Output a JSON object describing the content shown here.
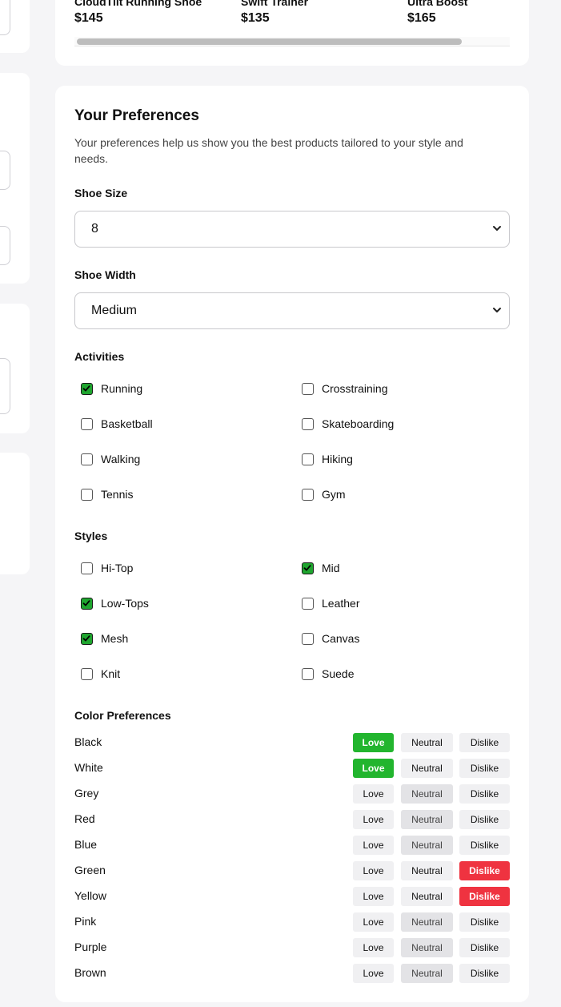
{
  "products": [
    {
      "name": "CloudTilt Running Shoe",
      "price": "$145"
    },
    {
      "name": "Swift Trainer",
      "price": "$135"
    },
    {
      "name": "Ultra Boost",
      "price": "$165"
    }
  ],
  "preferences": {
    "title": "Your Preferences",
    "description": "Your preferences help us show you the best products tailored to your style and needs.",
    "shoe_size": {
      "label": "Shoe Size",
      "value": "8"
    },
    "shoe_width": {
      "label": "Shoe Width",
      "value": "Medium"
    },
    "activities": {
      "label": "Activities",
      "items": [
        {
          "label": "Running",
          "checked": true
        },
        {
          "label": "Crosstraining",
          "checked": false
        },
        {
          "label": "Basketball",
          "checked": false
        },
        {
          "label": "Skateboarding",
          "checked": false
        },
        {
          "label": "Walking",
          "checked": false
        },
        {
          "label": "Hiking",
          "checked": false
        },
        {
          "label": "Tennis",
          "checked": false
        },
        {
          "label": "Gym",
          "checked": false
        }
      ]
    },
    "styles": {
      "label": "Styles",
      "items": [
        {
          "label": "Hi-Top",
          "checked": false
        },
        {
          "label": "Mid",
          "checked": true
        },
        {
          "label": "Low-Tops",
          "checked": true
        },
        {
          "label": "Leather",
          "checked": false
        },
        {
          "label": "Mesh",
          "checked": true
        },
        {
          "label": "Canvas",
          "checked": false
        },
        {
          "label": "Knit",
          "checked": false
        },
        {
          "label": "Suede",
          "checked": false
        }
      ]
    },
    "colors": {
      "label": "Color Preferences",
      "button_labels": {
        "love": "Love",
        "neutral": "Neutral",
        "dislike": "Dislike"
      },
      "items": [
        {
          "name": "Black",
          "selected": "love"
        },
        {
          "name": "White",
          "selected": "love"
        },
        {
          "name": "Grey",
          "selected": "neutral"
        },
        {
          "name": "Red",
          "selected": "neutral"
        },
        {
          "name": "Blue",
          "selected": "neutral"
        },
        {
          "name": "Green",
          "selected": "dislike"
        },
        {
          "name": "Yellow",
          "selected": "dislike"
        },
        {
          "name": "Pink",
          "selected": "neutral"
        },
        {
          "name": "Purple",
          "selected": "neutral"
        },
        {
          "name": "Brown",
          "selected": "neutral"
        }
      ]
    }
  },
  "theme": {
    "love": "#22b52e",
    "dislike": "#ef3340",
    "check": "#1fa52f"
  }
}
